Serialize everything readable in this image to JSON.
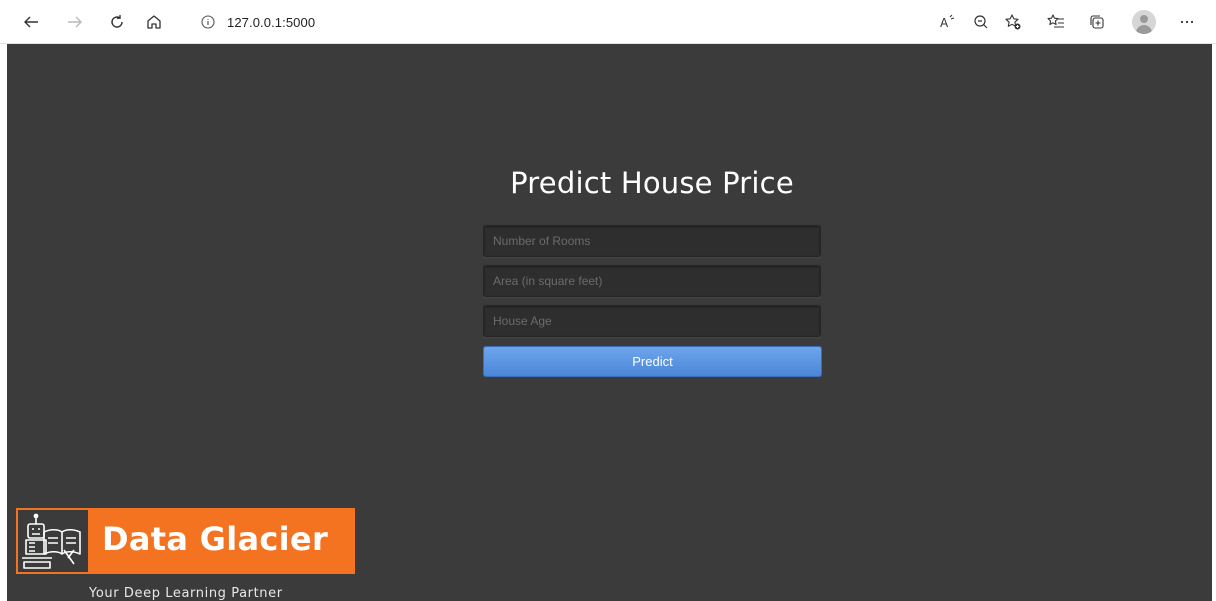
{
  "browser": {
    "url": "127.0.0.1:5000",
    "icons": {
      "back": "arrow-left-icon",
      "forward": "arrow-right-icon",
      "refresh": "refresh-icon",
      "home": "home-icon",
      "site_info": "info-circle-icon",
      "read_aloud": "read-aloud-icon",
      "zoom": "zoom-out-icon",
      "favorite": "add-favorite-icon",
      "favorites": "favorites-list-icon",
      "collections": "collections-icon",
      "profile": "profile-avatar-icon",
      "more": "more-menu-icon"
    }
  },
  "page": {
    "background_color": "#3b3b3b",
    "title": "Predict House Price",
    "form": {
      "rooms_placeholder": "Number of Rooms",
      "area_placeholder": "Area (in square feet)",
      "age_placeholder": "House Age",
      "submit_label": "Predict",
      "submit_color": "#5a95e2"
    },
    "brand": {
      "name": "Data Glacier",
      "tagline": "Your Deep Learning Partner",
      "color": "#f47321"
    }
  }
}
